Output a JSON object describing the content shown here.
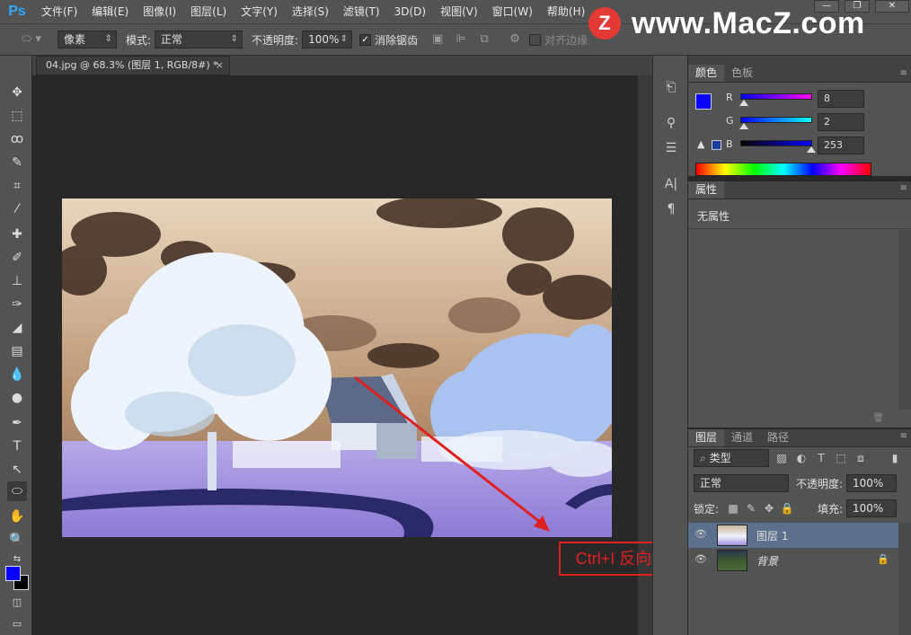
{
  "app": {
    "logo": "Ps"
  },
  "menu": [
    "文件(F)",
    "编辑(E)",
    "图像(I)",
    "图层(L)",
    "文字(Y)",
    "选择(S)",
    "滤镜(T)",
    "3D(D)",
    "视图(V)",
    "窗口(W)",
    "帮助(H)"
  ],
  "window_controls": {
    "minimize": "—",
    "maximize": "❐",
    "close": "✕"
  },
  "watermark": {
    "logo_letter": "Z",
    "text": "www.MacZ.com"
  },
  "options": {
    "unit_select": "像素",
    "mode_label": "模式:",
    "mode_value": "正常",
    "opacity_label": "不透明度:",
    "opacity_value": "100%",
    "antialias_label": "消除锯齿",
    "antialias_checked": true,
    "align_edges_label": "对齐边缘"
  },
  "document": {
    "tab_title": "04.jpg @ 68.3% (图层 1, RGB/8#) *",
    "close": "×"
  },
  "annotation": {
    "text": "Ctrl+I 反向",
    "color": "#e02020"
  },
  "color_panel": {
    "tabs": [
      "颜色",
      "色板"
    ],
    "active_tab": 0,
    "foreground": "#0802fd",
    "background": "#000000",
    "r_label": "R",
    "r_value": "8",
    "g_label": "G",
    "g_value": "2",
    "b_label": "B",
    "b_value": "253"
  },
  "properties_panel": {
    "tabs": [
      "属性"
    ],
    "content": "无属性"
  },
  "layers_panel": {
    "tabs": [
      "图层",
      "通道",
      "路径"
    ],
    "active_tab": 0,
    "filter_label": "类型",
    "blend_mode": "正常",
    "opacity_label": "不透明度:",
    "opacity_value": "100%",
    "lock_label": "锁定:",
    "fill_label": "填充:",
    "fill_value": "100%",
    "layers": [
      {
        "name": "图层 1",
        "selected": true
      },
      {
        "name": "背景",
        "locked": true
      }
    ]
  }
}
